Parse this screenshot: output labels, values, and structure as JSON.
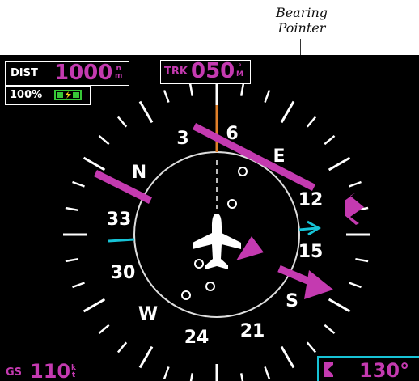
{
  "callout": {
    "line1": "Bearing",
    "line2": "Pointer"
  },
  "dist": {
    "label": "DIST",
    "value": "1000",
    "unit_top": "n",
    "unit_bottom": "m"
  },
  "battery": {
    "percent": "100%",
    "status": "charging",
    "icon": "battery-charging-icon",
    "color": "#37c837"
  },
  "track": {
    "label": "TRK",
    "value": "050",
    "unit_top": "°",
    "unit_bottom": "M"
  },
  "groundspeed": {
    "label": "GS",
    "value": "110",
    "unit_top": "k",
    "unit_bottom": "t"
  },
  "heading_box": {
    "icon": "heading-bug-icon",
    "value": "130°"
  },
  "compass": {
    "cardinal_labels": [
      "N",
      "3",
      "6",
      "E",
      "12",
      "15",
      "S",
      "21",
      "24",
      "W",
      "30",
      "33"
    ],
    "icons": [
      "aircraft-icon",
      "bearing-pointer-icon",
      "course-arrow-icon",
      "heading-bug-icon",
      "track-line-icon"
    ]
  },
  "colors": {
    "magenta": "#c43ab0",
    "cyan": "#17c3d6",
    "track": "#e0802a",
    "white": "#ffffff",
    "background": "#000000"
  }
}
